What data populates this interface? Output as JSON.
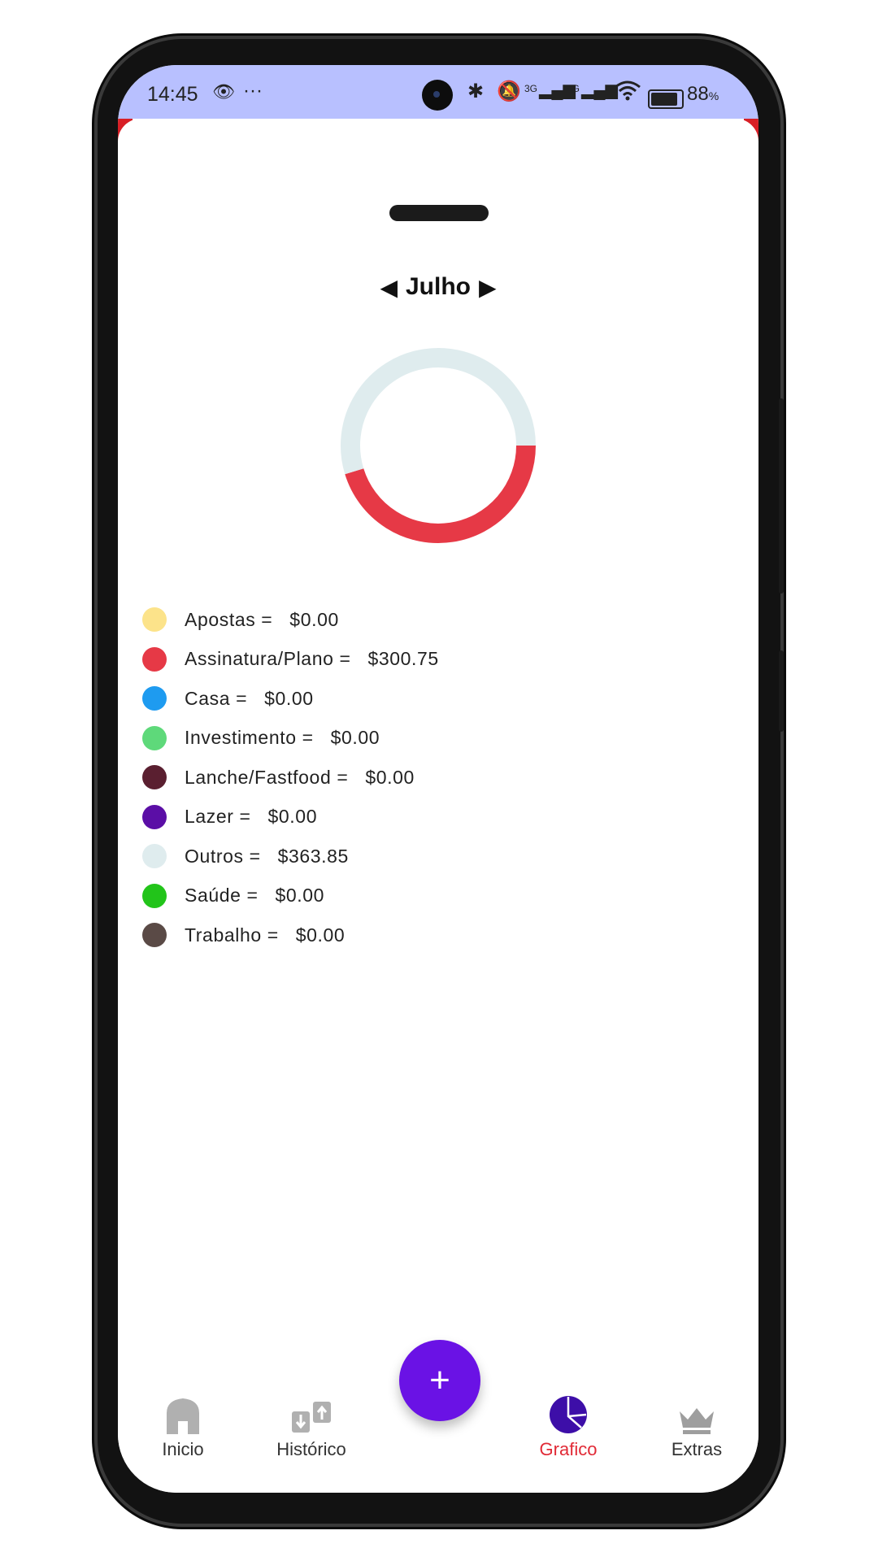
{
  "status_bar": {
    "time": "14:45",
    "signal_3g": "3G",
    "signal_4g": "4G",
    "battery_pct": "88",
    "battery_unit": "%"
  },
  "header": {
    "month": "Julho",
    "prev_icon": "caret-left-icon",
    "next_icon": "caret-right-icon"
  },
  "chart_data": {
    "type": "pie",
    "style": "donut",
    "categories": [
      "Apostas",
      "Assinatura/Plano",
      "Casa",
      "Investimento",
      "Lanche/Fastfood",
      "Lazer",
      "Outros",
      "Saúde",
      "Trabalho"
    ],
    "values": [
      0.0,
      300.75,
      0.0,
      0.0,
      0.0,
      0.0,
      363.85,
      0.0,
      0.0
    ],
    "colors": [
      "#fce38a",
      "#e63946",
      "#1e9bf0",
      "#5ed97a",
      "#5a1f30",
      "#5b0ea6",
      "#dfecee",
      "#22c41a",
      "#5a4a46"
    ]
  },
  "legend": [
    {
      "label": "Apostas =   $0.00",
      "color": "#fce38a"
    },
    {
      "label": "Assinatura/Plano =   $300.75",
      "color": "#e63946"
    },
    {
      "label": "Casa =   $0.00",
      "color": "#1e9bf0"
    },
    {
      "label": "Investimento =   $0.00",
      "color": "#5ed97a"
    },
    {
      "label": "Lanche/Fastfood =   $0.00",
      "color": "#5a1f30"
    },
    {
      "label": "Lazer =   $0.00",
      "color": "#5b0ea6"
    },
    {
      "label": "Outros =   $363.85",
      "color": "#dfecee"
    },
    {
      "label": "Saúde =   $0.00",
      "color": "#22c41a"
    },
    {
      "label": "Trabalho =   $0.00",
      "color": "#5a4a46"
    }
  ],
  "bottom_nav": {
    "items": [
      {
        "label": "Inicio",
        "icon": "home-icon"
      },
      {
        "label": "Histórico",
        "icon": "transfer-icon"
      },
      {
        "label": "Grafico",
        "icon": "pie-chart-icon",
        "active": true
      },
      {
        "label": "Extras",
        "icon": "crown-icon"
      }
    ],
    "fab_label": "+",
    "active_color": "#e12a36",
    "fab_color": "#6a12e5"
  }
}
